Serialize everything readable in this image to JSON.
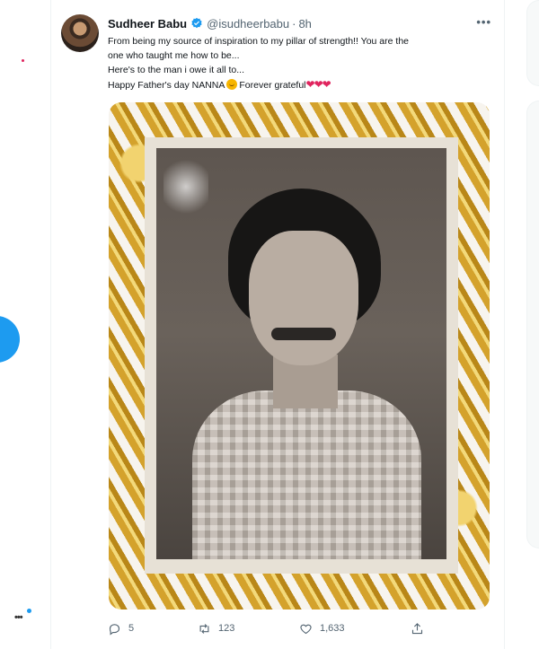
{
  "tweet": {
    "author_name": "Sudheer Babu",
    "handle": "@isudheerbabu",
    "separator": "·",
    "time": "8h",
    "more_label": "•••",
    "text_line1": "From being my source of inspiration to my pillar of strength!! You are the",
    "text_line2": "one who taught me how to be...",
    "text_line3": "Here's to the man i owe it all to...",
    "text_line4_start": "Happy Father's day NANNA",
    "text_line4_end": "Forever grateful",
    "hearts": "❤❤❤",
    "replies": "5",
    "retweets": "123",
    "likes": "1,633"
  },
  "colors": {
    "accent": "#1d9bf0",
    "text": "#0f1419",
    "muted": "#536471",
    "heart": "#e0245e"
  },
  "icons": {
    "verified": "verified-badge-icon",
    "reply": "reply-icon",
    "retweet": "retweet-icon",
    "like": "heart-icon",
    "share": "share-icon"
  }
}
